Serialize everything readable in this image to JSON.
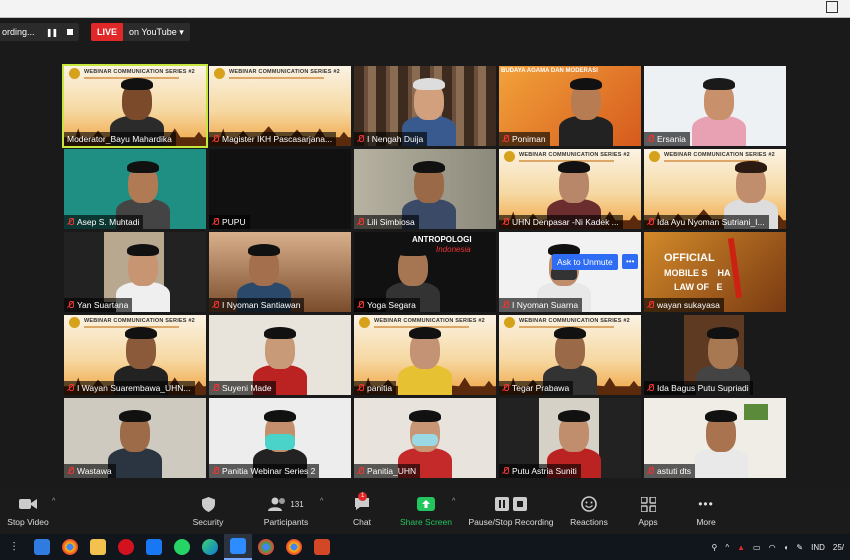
{
  "recording": {
    "status_text": "ording...",
    "pause_glyph": "❚❚",
    "live_badge": "LIVE",
    "live_target": "on YouTube",
    "live_caret": "▾"
  },
  "popup": {
    "unmute_label": "Ask to Unmute",
    "more_label": "•••"
  },
  "participants": [
    "Moderator_Bayu Mahardika",
    "Magister IKH Pascasarjana...",
    "I Nengah Duija",
    "Poniman",
    "Ersania",
    "Asep S. Muhtadi",
    "PUPU",
    "Lili Simbiosa",
    "UHN Denpasar -Ni Kadek ...",
    "Ida Ayu Nyoman Sutriani_I...",
    "Yan Suartana",
    "I Nyoman Santiawan",
    "Yoga Segara",
    "I Nyoman Suarna",
    "wayan sukayasa",
    "I Wayan Suarembawa_UHN...",
    "Suyeni Made",
    "panitia",
    "Tegar Prabawa",
    "Ida Bagus Putu Supriadi",
    "Wastawa",
    "Panitia Webinar Series 2",
    "Panitia_UHN",
    "Putu Astria Suniti",
    "astuti dts"
  ],
  "banner_text": "WEBINAR COMMUNICATION SERIES #2",
  "tile_texts": {
    "budaya": "BUDAYA AGAMA DAN MODERASI",
    "antropologi": "ANTROPOLOGI",
    "antropologi_sub": "Indonesia",
    "official": "OFFICIAL",
    "mobile": "MOBILE S    HA",
    "law": "LAW OF   E"
  },
  "toolbar": {
    "stop_video": "Stop Video",
    "security": "Security",
    "participants": "Participants",
    "participants_count": "131",
    "chat": "Chat",
    "chat_badge": "1",
    "share_screen": "Share Screen",
    "record": "Pause/Stop Recording",
    "reactions": "Reactions",
    "apps": "Apps",
    "more": "More",
    "caret": "^"
  },
  "taskbar": {
    "language": "IND",
    "date_fragment": "25/"
  },
  "colors": {
    "live": "#e02828",
    "active_speaker": "#c5e63a",
    "share_green": "#22c55e",
    "accent_blue": "#2d6cf3"
  }
}
